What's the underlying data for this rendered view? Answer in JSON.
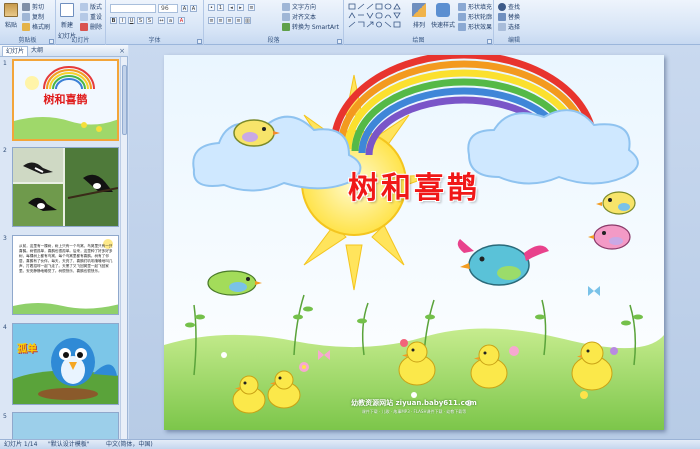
{
  "ribbon": {
    "clipboard": {
      "group": "剪贴板",
      "paste": "粘贴",
      "cut": "剪切",
      "copy": "复制",
      "format_painter": "格式刷"
    },
    "slides": {
      "group": "幻灯片",
      "new_slide": "新建",
      "new_slide2": "幻灯片",
      "layout": "版式",
      "reset": "重设",
      "delete": "删除"
    },
    "font": {
      "group": "字体",
      "size": "96"
    },
    "paragraph": {
      "group": "段落",
      "text_direction": "文字方向",
      "align_text": "对齐文本",
      "smartart": "转换为 SmartArt"
    },
    "drawing": {
      "group": "绘图",
      "arrange": "排列",
      "quick_styles": "快速样式",
      "shape_fill": "形状填充",
      "shape_outline": "形状轮廓",
      "shape_effects": "形状效果"
    },
    "editing": {
      "group": "编辑",
      "find": "查找",
      "replace": "替换",
      "select": "选择"
    }
  },
  "left_pane": {
    "tab_slides": "幻灯片",
    "tab_outline": "大纲",
    "close": "×",
    "slides": [
      {
        "number": "1",
        "title": "树和喜鹊"
      },
      {
        "number": "2"
      },
      {
        "number": "3",
        "text": "从前，这里有一棵树，树上只有一个鸟窝，鸟窝里只有一只喜鹊。树很孤单，喜鹊也很孤单。后来，这里种了好多好多树，每棵树上都有鸟窝，每个鸟窝里都有喜鹊。树有了邻居，喜鹊有了伙伴。每天，天亮了，喜鹊们叽叽喳喳地叫几声，打着招呼一起飞走了。天黑了又飞回窝里一起飞回家里。安安静静地睡觉了。树很快乐，喜鹊也很快乐。"
      },
      {
        "number": "4",
        "text": "孤单"
      },
      {
        "number": "5"
      }
    ]
  },
  "slide": {
    "title": "树和喜鹊",
    "site": "幼教资源网站 ziyuan.baby611.com",
    "site_sub": "课件下载 · 儿歌 · 故事MP3 · FLASH课件下载 · 幼教下载等"
  },
  "status": {
    "slide_info": "幻灯片 1/14",
    "theme": "\"默认设计模板\"",
    "language": "中文(简体，中国)"
  }
}
